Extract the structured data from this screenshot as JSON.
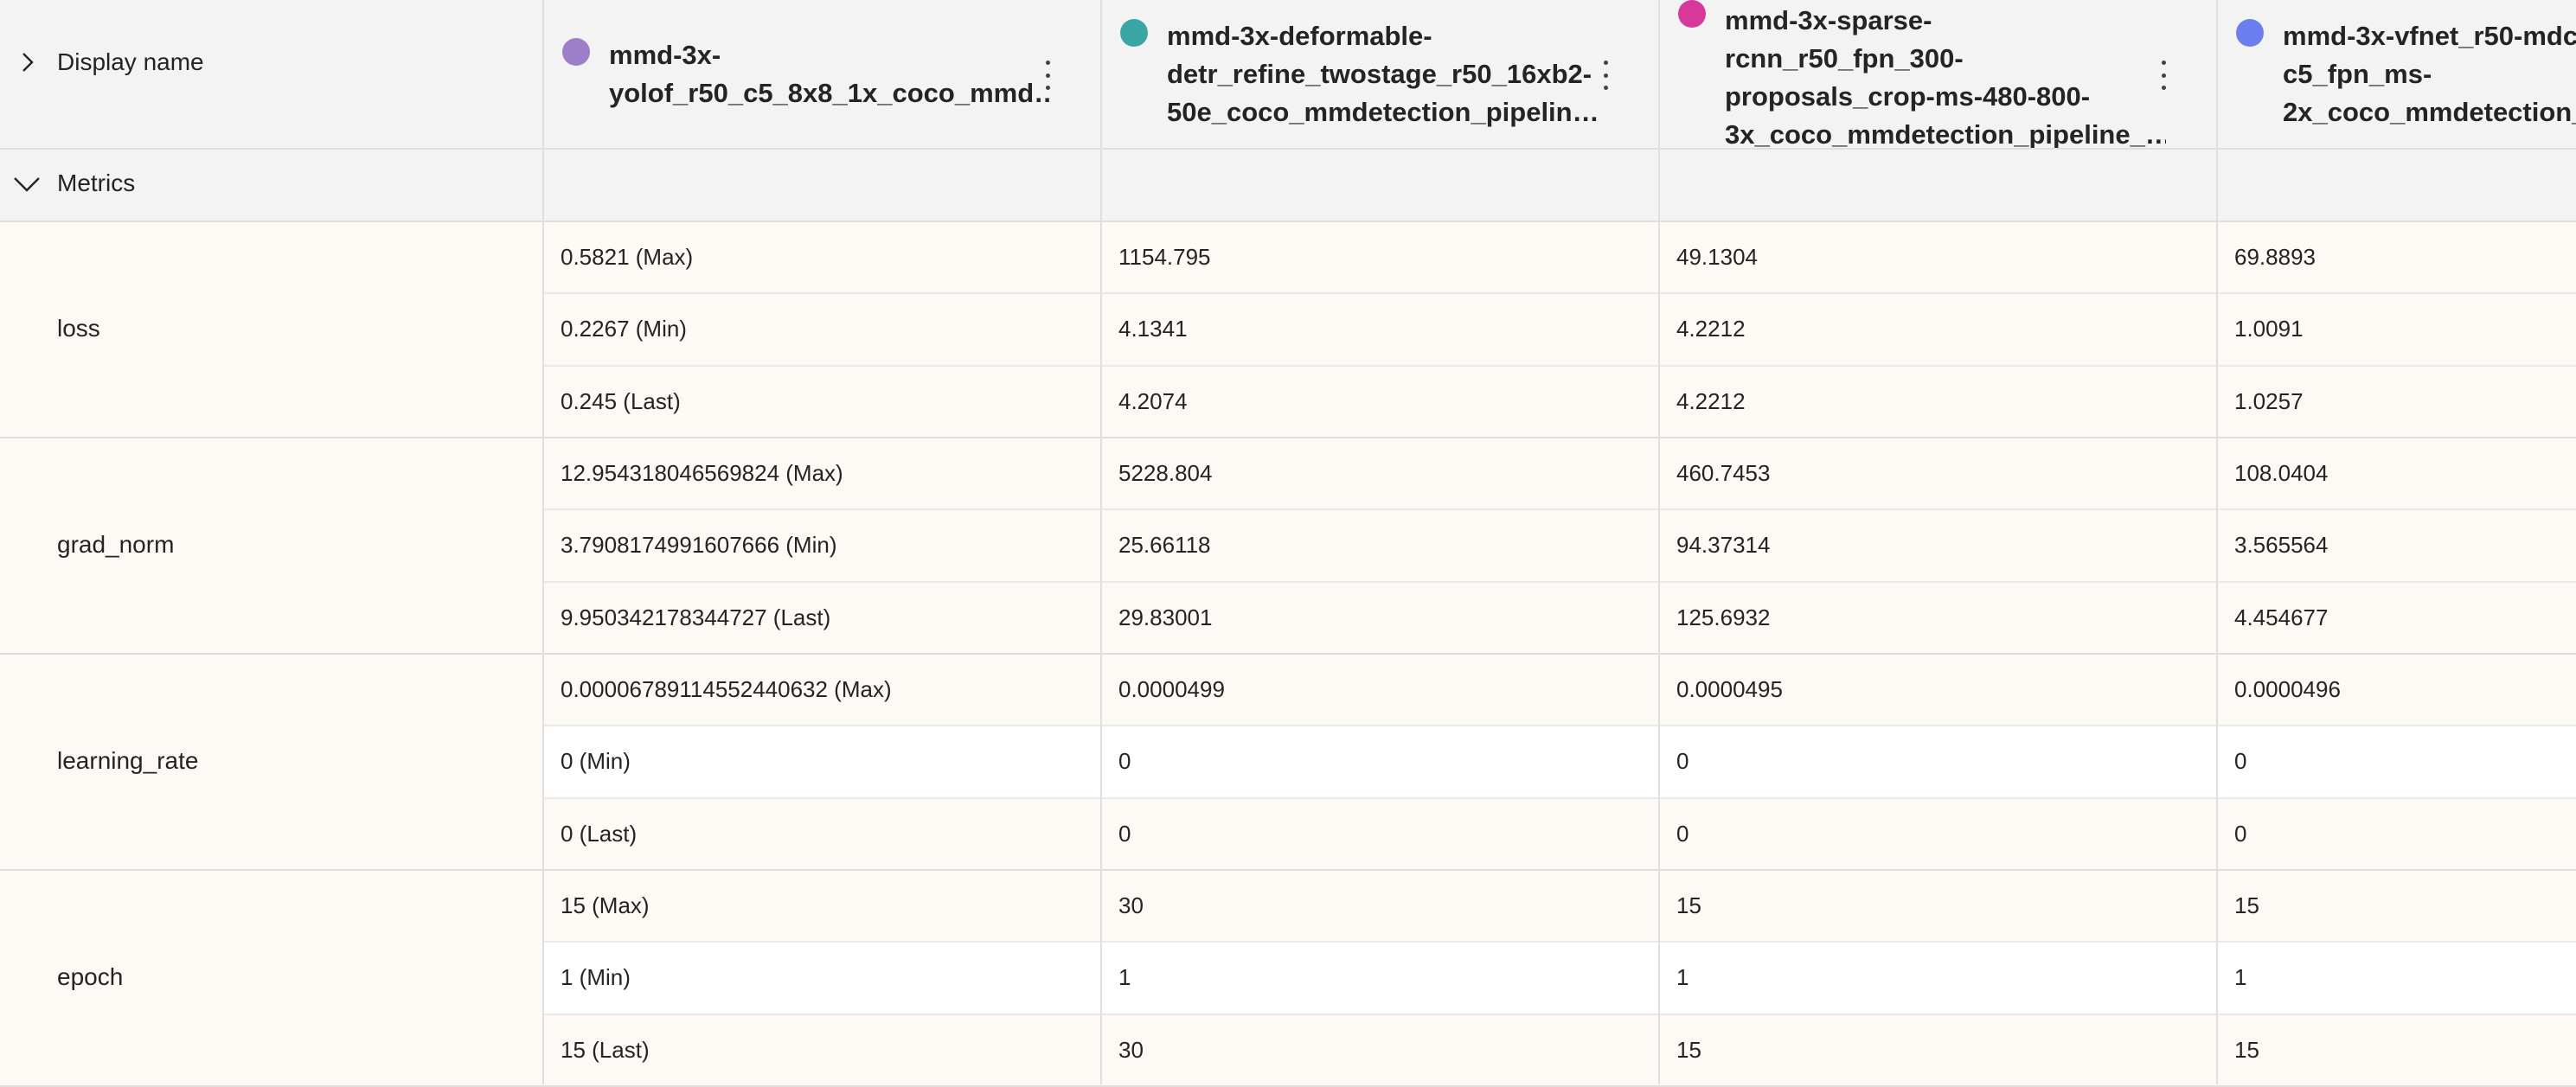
{
  "header": {
    "display_name_label": "Display name",
    "metrics_label": "Metrics"
  },
  "columns": [
    {
      "title": "mmd-3x-\nyolof_r50_c5_8x8_1x_coco_mmd…",
      "color": "#9c7ec9"
    },
    {
      "title": "mmd-3x-deformable-\ndetr_refine_twostage_r50_16xb2-\n50e_coco_mmdetection_pipelin…",
      "color": "#3aa6a6"
    },
    {
      "title": "mmd-3x-sparse-\nrcnn_r50_fpn_300-\nproposals_crop-ms-480-800-\n3x_coco_mmdetection_pipeline_…",
      "color": "#d6399a"
    },
    {
      "title": "mmd-3x-vfnet_r50-mdc\nc5_fpn_ms-\n2x_coco_mmdetection_…",
      "color": "#6b7ff0"
    }
  ],
  "metrics": [
    {
      "name": "loss",
      "rows": [
        [
          "0.5821 (Max)",
          "1154.795",
          "49.1304",
          "69.8893"
        ],
        [
          "0.2267 (Min)",
          "4.1341",
          "4.2212",
          "1.0091"
        ],
        [
          "0.245 (Last)",
          "4.2074",
          "4.2212",
          "1.0257"
        ]
      ]
    },
    {
      "name": "grad_norm",
      "rows": [
        [
          "12.954318046569824 (Max)",
          "5228.804",
          "460.7453",
          "108.0404"
        ],
        [
          "3.7908174991607666 (Min)",
          "25.66118",
          "94.37314",
          "3.565564"
        ],
        [
          "9.950342178344727 (Last)",
          "29.83001",
          "125.6932",
          "4.454677"
        ]
      ]
    },
    {
      "name": "learning_rate",
      "rows": [
        [
          "0.00006789114552440632 (Max)",
          "0.0000499",
          "0.0000495",
          "0.0000496"
        ],
        [
          "0 (Min)",
          "0",
          "0",
          "0"
        ],
        [
          "0 (Last)",
          "0",
          "0",
          "0"
        ]
      ]
    },
    {
      "name": "epoch",
      "rows": [
        [
          "15 (Max)",
          "30",
          "15",
          "15"
        ],
        [
          "1 (Min)",
          "1",
          "1",
          "1"
        ],
        [
          "15 (Last)",
          "30",
          "15",
          "15"
        ]
      ]
    }
  ]
}
